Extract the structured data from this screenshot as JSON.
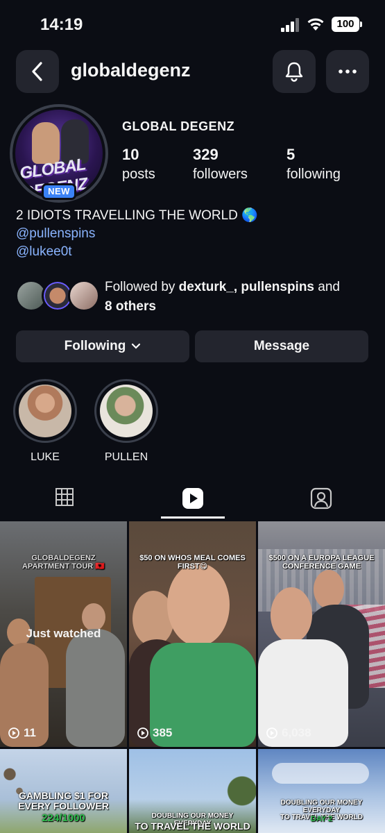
{
  "status_bar": {
    "time": "14:19",
    "battery": "100"
  },
  "header": {
    "username": "globaldegenz"
  },
  "profile": {
    "full_name": "GLOBAL DEGENZ",
    "avatar_text": "GLOBAL DEGENZ",
    "badge": "NEW",
    "stats": [
      {
        "value": "10",
        "label": "posts"
      },
      {
        "value": "329",
        "label": "followers"
      },
      {
        "value": "5",
        "label": "following"
      }
    ],
    "bio": {
      "line1": "2 IDIOTS TRAVELLING THE WORLD 🌎",
      "link1": "@pullenspins",
      "link2": "@lukee0t"
    },
    "followed_by": {
      "prefix": "Followed by ",
      "names": "dexturk_, pullenspins",
      "middle": " and",
      "others": "8 others"
    }
  },
  "actions": {
    "following_label": "Following",
    "message_label": "Message"
  },
  "highlights": [
    {
      "label": "LUKE"
    },
    {
      "label": "PULLEN"
    }
  ],
  "tabs": [
    {
      "name": "grid-icon"
    },
    {
      "name": "reels-icon",
      "active": true
    },
    {
      "name": "tagged-icon"
    }
  ],
  "reels": [
    {
      "caption": "GLOBALDEGENZ\nAPARTMENT TOUR 🇦🇱",
      "views": "11",
      "overlay": "Just watched"
    },
    {
      "caption": "$50 ON WHOS MEAL COMES\nFIRST😋",
      "views": "385"
    },
    {
      "caption": "$500 ON A EUROPA LEAGUE\nCONFERENCE GAME",
      "views": "6,038"
    },
    {
      "caption_line1": "GAMBLING $1 FOR\nEVERY FOLLOWER",
      "caption_line2": "224/1000"
    },
    {
      "caption_line1": "DOUBLING OUR MONEY EVERYDAY",
      "caption_line2": "TO TRAVEL THE WORLD"
    },
    {
      "caption_line1": "DOUBLING OUR MONEY EVERYDAY\nTO TRAVEL THE WORLD",
      "caption_line2": "DAY 2"
    }
  ],
  "colors": {
    "background": "#0b0d14",
    "button": "#23252e",
    "link": "#8ab4ff",
    "badge": "#3b82f6"
  }
}
